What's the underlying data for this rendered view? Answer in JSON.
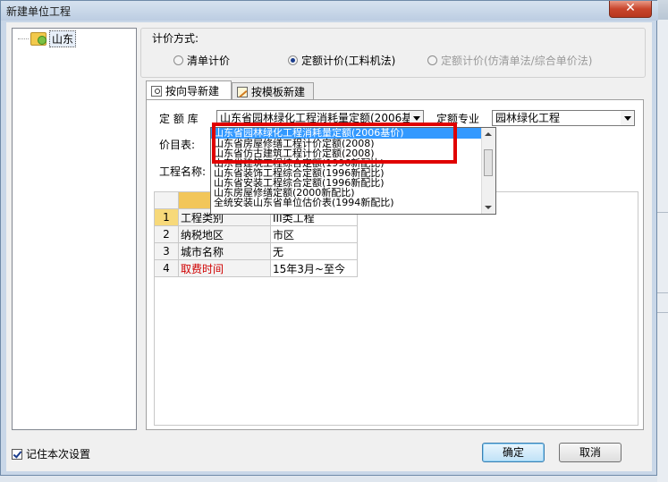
{
  "window": {
    "title": "新建单位工程",
    "close_glyph": "✕"
  },
  "tree": {
    "items": [
      {
        "label": "山东",
        "icon": "folder-region-icon"
      }
    ]
  },
  "pricing": {
    "group_label": "计价方式:",
    "options": [
      {
        "label": "清单计价",
        "selected": false,
        "disabled": false
      },
      {
        "label": "定额计价(工料机法)",
        "selected": true,
        "disabled": false
      },
      {
        "label": "定额计价(仿清单法/综合单价法)",
        "selected": false,
        "disabled": true
      }
    ]
  },
  "tabs": [
    {
      "label": "按向导新建",
      "active": true,
      "icon": "magnifier-page-icon"
    },
    {
      "label": "按模板新建",
      "active": false,
      "icon": "pencil-page-icon"
    }
  ],
  "form": {
    "quota_lib_label": "定 额 库",
    "quota_lib_value": "山东省园林绿化工程消耗量定额(2006基",
    "quota_major_label": "定额专业",
    "quota_major_value": "园林绿化工程",
    "price_table_label": "价目表:",
    "project_name_label": "工程名称:"
  },
  "dropdown": {
    "items": [
      "山东省园林绿化工程消耗量定额(2006基价)",
      "山东省房屋修缮工程计价定额(2008)",
      "山东省仿古建筑工程计价定额(2008)",
      "山东省建筑工程综合定额(1996新配比)",
      "山东省装饰工程综合定额(1996新配比)",
      "山东省安装工程综合定额(1996新配比)",
      "山东房屋修缮定额(2000新配比)",
      "全统安装山东省单位估价表(1994新配比)"
    ],
    "selected_index": 0
  },
  "grid": {
    "rows": [
      {
        "num": "1",
        "name": "工程类别",
        "value": "III类工程"
      },
      {
        "num": "2",
        "name": "纳税地区",
        "value": "市区"
      },
      {
        "num": "3",
        "name": "城市名称",
        "value": "无"
      },
      {
        "num": "4",
        "name": "取费时间",
        "value": "15年3月~至今"
      }
    ]
  },
  "footer": {
    "remember_label": "记住本次设置",
    "remember_checked": true,
    "ok_label": "确定",
    "cancel_label": "取消"
  },
  "colors": {
    "highlight": "#e00000",
    "selection": "#3399ff",
    "required_field": "#d00000"
  }
}
